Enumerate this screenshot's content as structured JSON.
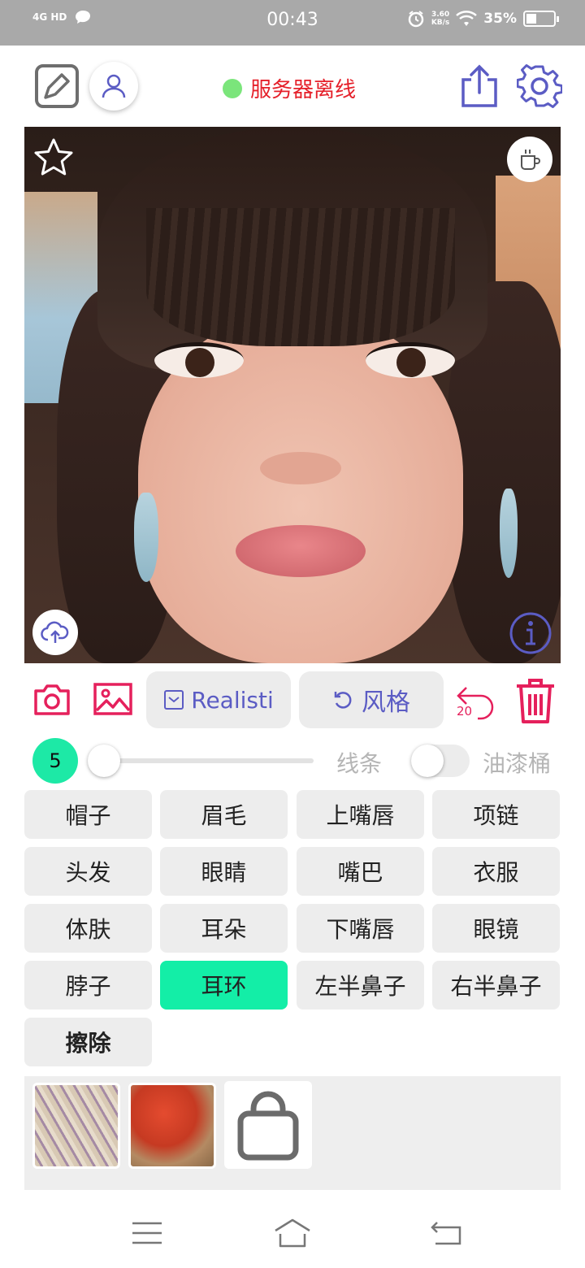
{
  "status_bar": {
    "network": "4G HD",
    "time": "00:43",
    "speed_value": "3.60",
    "speed_unit": "KB/s",
    "battery": "35%"
  },
  "toolbar": {
    "server_status": "服务器离线",
    "server_status_color": "#e5202a",
    "status_dot_color": "#7be57b"
  },
  "actions": {
    "model_label": "Realisti",
    "style_label": "风格",
    "undo_count": "20"
  },
  "brush": {
    "size": "5",
    "slider_level": 0,
    "line_label": "线条",
    "bucket_label": "油漆桶",
    "bucket_enabled": false
  },
  "parts": [
    {
      "label": "帽子"
    },
    {
      "label": "眉毛"
    },
    {
      "label": "上嘴唇"
    },
    {
      "label": "项链"
    },
    {
      "label": "头发"
    },
    {
      "label": "眼睛"
    },
    {
      "label": "嘴巴"
    },
    {
      "label": "衣服"
    },
    {
      "label": "体肤"
    },
    {
      "label": "耳朵"
    },
    {
      "label": "下嘴唇"
    },
    {
      "label": "眼镜"
    },
    {
      "label": "脖子"
    },
    {
      "label": "耳环"
    },
    {
      "label": "左半鼻子"
    },
    {
      "label": "右半鼻子"
    },
    {
      "label": "擦除"
    }
  ],
  "selected_part": "耳环",
  "colors": {
    "accent_purple": "#5b5cc4",
    "accent_red": "#e5205c",
    "accent_green": "#13eea7"
  }
}
